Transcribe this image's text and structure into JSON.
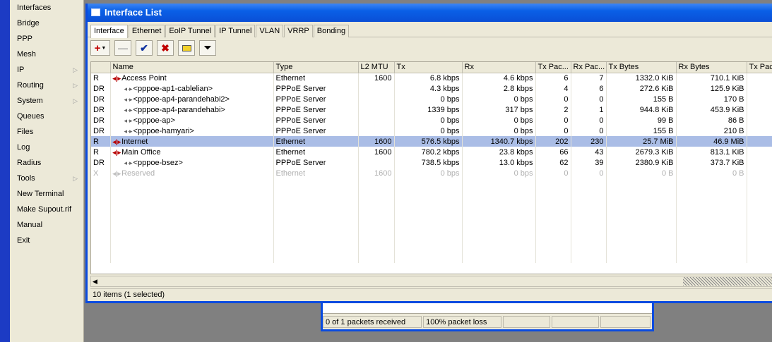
{
  "menu": {
    "items": [
      {
        "label": "Interfaces",
        "submenu": false
      },
      {
        "label": "Bridge",
        "submenu": false
      },
      {
        "label": "PPP",
        "submenu": false
      },
      {
        "label": "Mesh",
        "submenu": false
      },
      {
        "label": "IP",
        "submenu": true
      },
      {
        "label": "Routing",
        "submenu": true
      },
      {
        "label": "System",
        "submenu": true
      },
      {
        "label": "Queues",
        "submenu": false
      },
      {
        "label": "Files",
        "submenu": false
      },
      {
        "label": "Log",
        "submenu": false
      },
      {
        "label": "Radius",
        "submenu": false
      },
      {
        "label": "Tools",
        "submenu": true
      },
      {
        "label": "New Terminal",
        "submenu": false
      },
      {
        "label": "Make Supout.rif",
        "submenu": false
      },
      {
        "label": "Manual",
        "submenu": false
      },
      {
        "label": "Exit",
        "submenu": false
      }
    ]
  },
  "window": {
    "title": "Interface List",
    "tabs": [
      "Interface",
      "Ethernet",
      "EoIP Tunnel",
      "IP Tunnel",
      "VLAN",
      "VRRP",
      "Bonding"
    ],
    "active_tab": "Interface",
    "toolbar": {
      "add_icon": "plus-dropdown-icon",
      "remove_icon": "minus-icon",
      "enable_icon": "checkmark-icon",
      "disable_icon": "x-icon",
      "comment_icon": "comment-icon",
      "filter_icon": "filter-icon"
    }
  },
  "table": {
    "columns": [
      "Name",
      "Type",
      "L2 MTU",
      "Tx",
      "Rx",
      "Tx Pac...",
      "Rx Pac...",
      "Tx Bytes",
      "Rx Bytes",
      "Tx Pac"
    ],
    "rows": [
      {
        "flag": "R",
        "indent": 0,
        "icon": "eth",
        "name": "Access Point",
        "type": "Ethernet",
        "l2mtu": "1600",
        "tx": "6.8 kbps",
        "rx": "4.6 kbps",
        "txp": "6",
        "rxp": "7",
        "txb": "1332.0 KiB",
        "rxb": "710.1 KiB",
        "state": "normal"
      },
      {
        "flag": "DR",
        "indent": 1,
        "icon": "ppp",
        "name": "<pppoe-ap1-cablelian>",
        "type": "PPPoE Server",
        "l2mtu": "",
        "tx": "4.3 kbps",
        "rx": "2.8 kbps",
        "txp": "4",
        "rxp": "6",
        "txb": "272.6 KiB",
        "rxb": "125.9 KiB",
        "state": "normal"
      },
      {
        "flag": "DR",
        "indent": 1,
        "icon": "ppp",
        "name": "<pppoe-ap4-parandehabi2>",
        "type": "PPPoE Server",
        "l2mtu": "",
        "tx": "0 bps",
        "rx": "0 bps",
        "txp": "0",
        "rxp": "0",
        "txb": "155 B",
        "rxb": "170 B",
        "state": "normal"
      },
      {
        "flag": "DR",
        "indent": 1,
        "icon": "ppp",
        "name": "<pppoe-ap4-parandehabi>",
        "type": "PPPoE Server",
        "l2mtu": "",
        "tx": "1339 bps",
        "rx": "317 bps",
        "txp": "2",
        "rxp": "1",
        "txb": "944.8 KiB",
        "rxb": "453.9 KiB",
        "state": "normal"
      },
      {
        "flag": "DR",
        "indent": 1,
        "icon": "ppp",
        "name": "<pppoe-ap>",
        "type": "PPPoE Server",
        "l2mtu": "",
        "tx": "0 bps",
        "rx": "0 bps",
        "txp": "0",
        "rxp": "0",
        "txb": "99 B",
        "rxb": "86 B",
        "state": "normal"
      },
      {
        "flag": "DR",
        "indent": 1,
        "icon": "ppp",
        "name": "<pppoe-hamyari>",
        "type": "PPPoE Server",
        "l2mtu": "",
        "tx": "0 bps",
        "rx": "0 bps",
        "txp": "0",
        "rxp": "0",
        "txb": "155 B",
        "rxb": "210 B",
        "state": "normal"
      },
      {
        "flag": "R",
        "indent": 0,
        "icon": "eth",
        "name": "Internet",
        "type": "Ethernet",
        "l2mtu": "1600",
        "tx": "576.5 kbps",
        "rx": "1340.7 kbps",
        "txp": "202",
        "rxp": "230",
        "txb": "25.7 MiB",
        "rxb": "46.9 MiB",
        "state": "selected"
      },
      {
        "flag": "R",
        "indent": 0,
        "icon": "eth",
        "name": "Main Office",
        "type": "Ethernet",
        "l2mtu": "1600",
        "tx": "780.2 kbps",
        "rx": "23.8 kbps",
        "txp": "66",
        "rxp": "43",
        "txb": "2679.3 KiB",
        "rxb": "813.1 KiB",
        "state": "normal"
      },
      {
        "flag": "DR",
        "indent": 1,
        "icon": "ppp",
        "name": "<pppoe-bsez>",
        "type": "PPPoE Server",
        "l2mtu": "",
        "tx": "738.5 kbps",
        "rx": "13.0 kbps",
        "txp": "62",
        "rxp": "39",
        "txb": "2380.9 KiB",
        "rxb": "373.7 KiB",
        "state": "normal"
      },
      {
        "flag": "X",
        "indent": 0,
        "icon": "eth",
        "name": "Reserved",
        "type": "Ethernet",
        "l2mtu": "1600",
        "tx": "0 bps",
        "rx": "0 bps",
        "txp": "0",
        "rxp": "0",
        "txb": "0 B",
        "rxb": "0 B",
        "state": "disabled"
      }
    ]
  },
  "status": {
    "text": "10 items (1 selected)"
  },
  "ping": {
    "received": "0 of 1 packets received",
    "loss": "100% packet loss"
  }
}
